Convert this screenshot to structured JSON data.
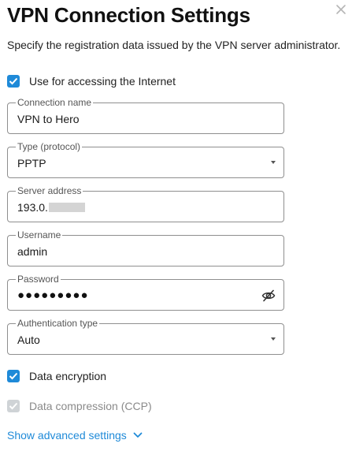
{
  "dialog": {
    "title": "VPN Connection Settings",
    "subtitle": "Specify the registration data issued by the VPN server administrator.",
    "close_icon": "close-icon"
  },
  "use_for_internet": {
    "label": "Use for accessing the Internet",
    "checked": true
  },
  "fields": {
    "connection_name": {
      "label": "Connection name",
      "value": "VPN to Hero"
    },
    "type": {
      "label": "Type (protocol)",
      "value": "PPTP"
    },
    "server_address": {
      "label": "Server address",
      "value": "193.0."
    },
    "username": {
      "label": "Username",
      "value": "admin"
    },
    "password": {
      "label": "Password",
      "value": "●●●●●●●●●",
      "visibility_icon": "eye-off-icon"
    },
    "auth_type": {
      "label": "Authentication type",
      "value": "Auto"
    }
  },
  "data_encryption": {
    "label": "Data encryption",
    "checked": true
  },
  "data_compression": {
    "label": "Data compression (CCP)",
    "checked": true,
    "disabled": true
  },
  "advanced": {
    "label": "Show advanced settings",
    "icon": "chevron-down-icon"
  },
  "colors": {
    "accent": "#1f8ad8",
    "border": "#8f8f8f",
    "disabled": "#cfd3d6"
  }
}
